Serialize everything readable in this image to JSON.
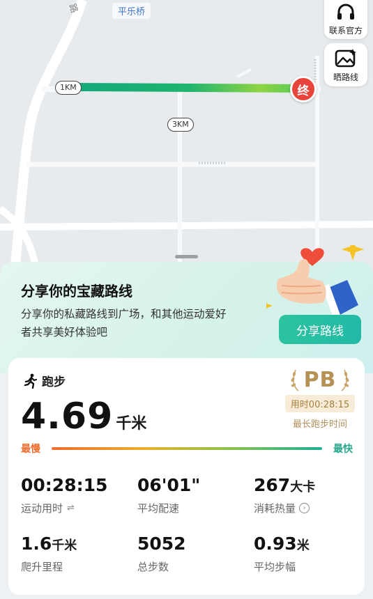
{
  "map": {
    "place_label": "平乐桥",
    "road_label": "路",
    "km_markers": [
      "1KM",
      "3KM"
    ],
    "end_marker": "终",
    "buttons": {
      "contact": "联系官方",
      "share_route": "晒路线"
    }
  },
  "promo": {
    "title": "分享你的宝藏路线",
    "description": "分享你的私藏路线到广场，和其他运动爱好者共享美好体验吧",
    "button": "分享路线"
  },
  "activity": {
    "type": "跑步",
    "distance": "4.69",
    "distance_unit": "千米",
    "pb": {
      "badge": "PB",
      "time_label": "用时00:28:15",
      "description": "最长跑步时间"
    },
    "pace_scale": {
      "slow": "最慢",
      "fast": "最快"
    }
  },
  "stats": [
    {
      "value": "00:28:15",
      "unit": "",
      "label": "运动用时"
    },
    {
      "value": "06'01\"",
      "unit": "",
      "label": "平均配速"
    },
    {
      "value": "267",
      "unit": "大卡",
      "label": "消耗热量"
    },
    {
      "value": "1.6",
      "unit": "千米",
      "label": "爬升里程"
    },
    {
      "value": "5052",
      "unit": "",
      "label": "总步数"
    },
    {
      "value": "0.93",
      "unit": "米",
      "label": "平均步幅"
    }
  ],
  "colors": {
    "accent_green": "#22b9a6",
    "pb_gold": "#b69154",
    "slow_orange": "#ef6c2d",
    "end_red": "#e9443b"
  }
}
